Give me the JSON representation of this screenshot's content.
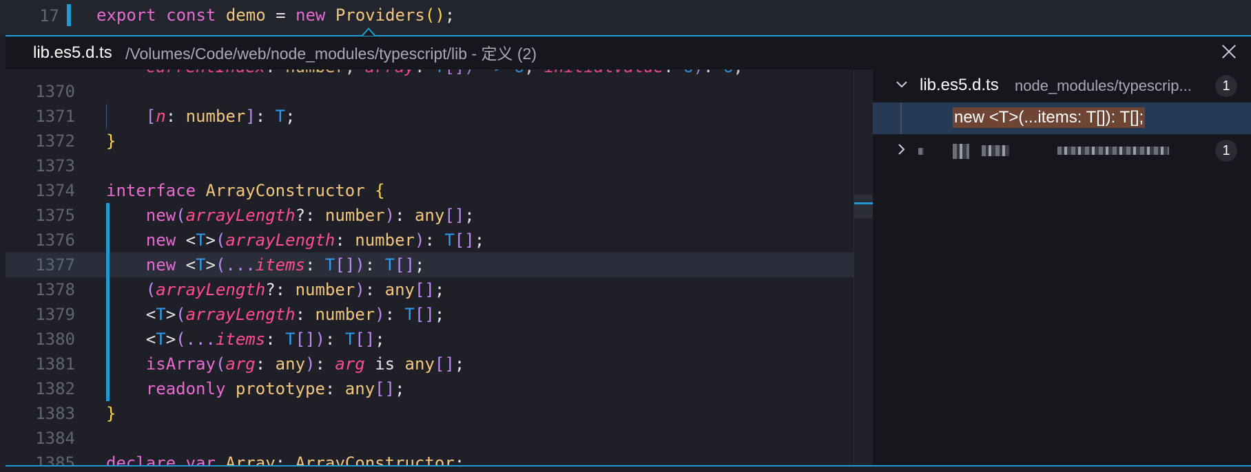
{
  "top_line": {
    "line_number": "17",
    "tokens": [
      {
        "t": "export",
        "c": "kw"
      },
      {
        "t": " ",
        "c": "op"
      },
      {
        "t": "const",
        "c": "kw"
      },
      {
        "t": " ",
        "c": "op"
      },
      {
        "t": "demo",
        "c": "ty"
      },
      {
        "t": " = ",
        "c": "op"
      },
      {
        "t": "new",
        "c": "kw"
      },
      {
        "t": " ",
        "c": "op"
      },
      {
        "t": "Providers",
        "c": "ty"
      },
      {
        "t": "()",
        "c": "pn"
      },
      {
        "t": ";",
        "c": "op"
      }
    ]
  },
  "peek": {
    "file_name": "lib.es5.d.ts",
    "path_title": "/Volumes/Code/web/node_modules/typescript/lib - 定义 (2)"
  },
  "code_lines": [
    {
      "num": "1370",
      "tokens": []
    },
    {
      "num": "1371",
      "tokens": [
        {
          "t": "    [",
          "c": "br"
        },
        {
          "t": "n",
          "c": "pa"
        },
        {
          "t": ": ",
          "c": "op"
        },
        {
          "t": "number",
          "c": "ty"
        },
        {
          "t": "]",
          "c": "br"
        },
        {
          "t": ": ",
          "c": "op"
        },
        {
          "t": "T",
          "c": "tp"
        },
        {
          "t": ";",
          "c": "op"
        }
      ]
    },
    {
      "num": "1372",
      "tokens": [
        {
          "t": "}",
          "c": "pn"
        }
      ]
    },
    {
      "num": "1373",
      "tokens": []
    },
    {
      "num": "1374",
      "tokens": [
        {
          "t": "interface",
          "c": "kw"
        },
        {
          "t": " ",
          "c": "op"
        },
        {
          "t": "ArrayConstructor",
          "c": "ty"
        },
        {
          "t": " ",
          "c": "op"
        },
        {
          "t": "{",
          "c": "pn"
        }
      ]
    },
    {
      "num": "1375",
      "tokens": [
        {
          "t": "    new",
          "c": "kw"
        },
        {
          "t": "(",
          "c": "br"
        },
        {
          "t": "arrayLength",
          "c": "pa"
        },
        {
          "t": "?: ",
          "c": "op"
        },
        {
          "t": "number",
          "c": "ty"
        },
        {
          "t": ")",
          "c": "br"
        },
        {
          "t": ": ",
          "c": "op"
        },
        {
          "t": "any",
          "c": "ty"
        },
        {
          "t": "[]",
          "c": "br"
        },
        {
          "t": ";",
          "c": "op"
        }
      ]
    },
    {
      "num": "1376",
      "tokens": [
        {
          "t": "    new",
          "c": "kw"
        },
        {
          "t": " <",
          "c": "op"
        },
        {
          "t": "T",
          "c": "tp"
        },
        {
          "t": ">",
          "c": "op"
        },
        {
          "t": "(",
          "c": "br"
        },
        {
          "t": "arrayLength",
          "c": "pa"
        },
        {
          "t": ": ",
          "c": "op"
        },
        {
          "t": "number",
          "c": "ty"
        },
        {
          "t": ")",
          "c": "br"
        },
        {
          "t": ": ",
          "c": "op"
        },
        {
          "t": "T",
          "c": "tp"
        },
        {
          "t": "[]",
          "c": "br"
        },
        {
          "t": ";",
          "c": "op"
        }
      ]
    },
    {
      "num": "1377",
      "highlight": true,
      "tokens": [
        {
          "t": "    new",
          "c": "kw"
        },
        {
          "t": " <",
          "c": "op"
        },
        {
          "t": "T",
          "c": "tp"
        },
        {
          "t": ">",
          "c": "op"
        },
        {
          "t": "(...",
          "c": "br"
        },
        {
          "t": "items",
          "c": "pa"
        },
        {
          "t": ": ",
          "c": "op"
        },
        {
          "t": "T",
          "c": "tp"
        },
        {
          "t": "[]",
          "c": "br"
        },
        {
          "t": ")",
          "c": "br"
        },
        {
          "t": ": ",
          "c": "op"
        },
        {
          "t": "T",
          "c": "tp"
        },
        {
          "t": "[]",
          "c": "br"
        },
        {
          "t": ";",
          "c": "op"
        }
      ]
    },
    {
      "num": "1378",
      "tokens": [
        {
          "t": "    (",
          "c": "br"
        },
        {
          "t": "arrayLength",
          "c": "pa"
        },
        {
          "t": "?: ",
          "c": "op"
        },
        {
          "t": "number",
          "c": "ty"
        },
        {
          "t": ")",
          "c": "br"
        },
        {
          "t": ": ",
          "c": "op"
        },
        {
          "t": "any",
          "c": "ty"
        },
        {
          "t": "[]",
          "c": "br"
        },
        {
          "t": ";",
          "c": "op"
        }
      ]
    },
    {
      "num": "1379",
      "tokens": [
        {
          "t": "    <",
          "c": "op"
        },
        {
          "t": "T",
          "c": "tp"
        },
        {
          "t": ">",
          "c": "op"
        },
        {
          "t": "(",
          "c": "br"
        },
        {
          "t": "arrayLength",
          "c": "pa"
        },
        {
          "t": ": ",
          "c": "op"
        },
        {
          "t": "number",
          "c": "ty"
        },
        {
          "t": ")",
          "c": "br"
        },
        {
          "t": ": ",
          "c": "op"
        },
        {
          "t": "T",
          "c": "tp"
        },
        {
          "t": "[]",
          "c": "br"
        },
        {
          "t": ";",
          "c": "op"
        }
      ]
    },
    {
      "num": "1380",
      "tokens": [
        {
          "t": "    <",
          "c": "op"
        },
        {
          "t": "T",
          "c": "tp"
        },
        {
          "t": ">",
          "c": "op"
        },
        {
          "t": "(...",
          "c": "br"
        },
        {
          "t": "items",
          "c": "pa"
        },
        {
          "t": ": ",
          "c": "op"
        },
        {
          "t": "T",
          "c": "tp"
        },
        {
          "t": "[]",
          "c": "br"
        },
        {
          "t": ")",
          "c": "br"
        },
        {
          "t": ": ",
          "c": "op"
        },
        {
          "t": "T",
          "c": "tp"
        },
        {
          "t": "[]",
          "c": "br"
        },
        {
          "t": ";",
          "c": "op"
        }
      ]
    },
    {
      "num": "1381",
      "tokens": [
        {
          "t": "    isArray",
          "c": "kw"
        },
        {
          "t": "(",
          "c": "br"
        },
        {
          "t": "arg",
          "c": "pa"
        },
        {
          "t": ": ",
          "c": "op"
        },
        {
          "t": "any",
          "c": "ty"
        },
        {
          "t": ")",
          "c": "br"
        },
        {
          "t": ": ",
          "c": "op"
        },
        {
          "t": "arg",
          "c": "pa"
        },
        {
          "t": " is ",
          "c": "op"
        },
        {
          "t": "any",
          "c": "ty"
        },
        {
          "t": "[]",
          "c": "br"
        },
        {
          "t": ";",
          "c": "op"
        }
      ]
    },
    {
      "num": "1382",
      "tokens": [
        {
          "t": "    readonly",
          "c": "kw"
        },
        {
          "t": " ",
          "c": "op"
        },
        {
          "t": "prototype",
          "c": "ty"
        },
        {
          "t": ": ",
          "c": "op"
        },
        {
          "t": "any",
          "c": "ty"
        },
        {
          "t": "[]",
          "c": "br"
        },
        {
          "t": ";",
          "c": "op"
        }
      ]
    },
    {
      "num": "1383",
      "tokens": [
        {
          "t": "}",
          "c": "pn"
        }
      ]
    },
    {
      "num": "1384",
      "tokens": []
    }
  ],
  "references": {
    "group1": {
      "file": "lib.es5.d.ts",
      "path": "node_modules/typescrip...",
      "count": "1"
    },
    "item": "new <T>(...items: T[]): T[];",
    "group2": {
      "count": "1"
    }
  }
}
